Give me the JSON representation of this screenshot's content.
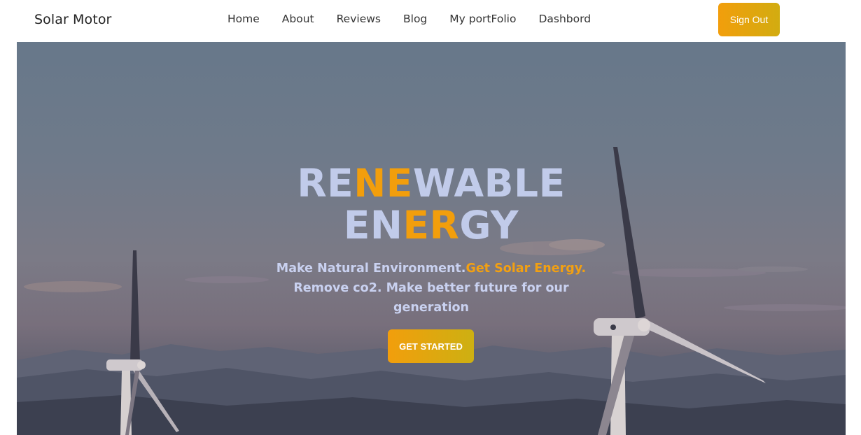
{
  "navbar": {
    "brand": "Solar Motor",
    "links": [
      "Home",
      "About",
      "Reviews",
      "Blog",
      "My portFolio",
      "Dashbord"
    ],
    "signout_label": "Sign Out"
  },
  "hero": {
    "title_line1": {
      "part1": "RE",
      "part2": "NE",
      "part3": "WABLE"
    },
    "title_line2": {
      "part1": "EN",
      "part2": "ER",
      "part3": "GY"
    },
    "subtitle_plain": "Make Natural Environment.",
    "subtitle_highlight": "Get Solar Energy.",
    "subtitle_rest": "Remove co2. Make better future for our generation",
    "cta_label": "GET STARTED"
  },
  "colors": {
    "accent": "#f29e0c",
    "title_text": "#c1cbea",
    "button_text": "#ffffff"
  }
}
